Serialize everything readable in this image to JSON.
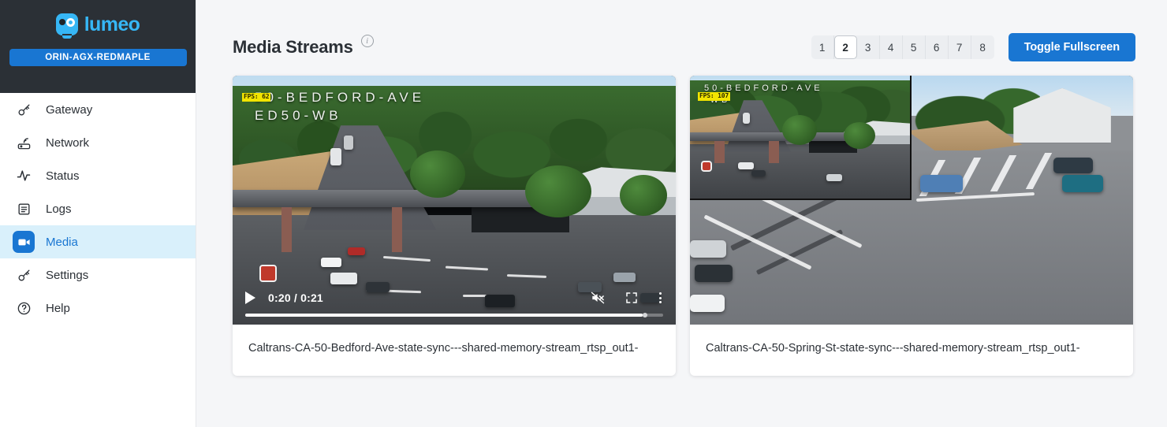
{
  "brand": {
    "logo_icon": "lumeo-logo-icon",
    "name": "lumeo",
    "device_badge": "ORIN-AGX-REDMAPLE"
  },
  "sidebar": {
    "items": [
      {
        "label": "Gateway",
        "icon": "key-icon",
        "active": false
      },
      {
        "label": "Network",
        "icon": "router-wifi-icon",
        "active": false
      },
      {
        "label": "Status",
        "icon": "pulse-activity-icon",
        "active": false
      },
      {
        "label": "Logs",
        "icon": "document-lines-icon",
        "active": false
      },
      {
        "label": "Media",
        "icon": "video-camera-icon",
        "active": true
      },
      {
        "label": "Settings",
        "icon": "key-icon",
        "active": false
      },
      {
        "label": "Help",
        "icon": "question-circle-icon",
        "active": false
      }
    ]
  },
  "header": {
    "title": "Media Streams",
    "info_icon": "info-circle-icon",
    "pages": [
      "1",
      "2",
      "3",
      "4",
      "5",
      "6",
      "7",
      "8"
    ],
    "active_page": "2",
    "fullscreen_label": "Toggle Fullscreen"
  },
  "colors": {
    "accent": "#1976d2",
    "sidebar_top_bg": "#2b3036",
    "logo_blue": "#36b6f5",
    "active_row_bg": "#d9f0fb",
    "page_bg": "#f5f6f8",
    "fps_badge_bg": "#f2e400"
  },
  "streams": [
    {
      "fps_label": "FPS: 62",
      "overlay_line1": "50-BEDFORD-AVE",
      "overlay_line2": "ED50-WB",
      "caption": "Caltrans-CA-50-Bedford-Ave-state-sync---shared-memory-stream_rtsp_out1-",
      "player": {
        "play_icon": "play-icon",
        "time": "0:20 / 0:21",
        "current_time": "0:20",
        "duration": "0:21",
        "progress_percent": 95,
        "mute_icon": "volume-muted-icon",
        "fullscreen_icon": "expand-icon",
        "more_icon": "more-vertical-icon"
      }
    },
    {
      "fps_label": "FPS: 107",
      "overlay_line1": "50-BEDFORD-AVE",
      "overlay_line2": "-WB",
      "caption": "Caltrans-CA-50-Spring-St-state-sync---shared-memory-stream_rtsp_out1-"
    }
  ]
}
